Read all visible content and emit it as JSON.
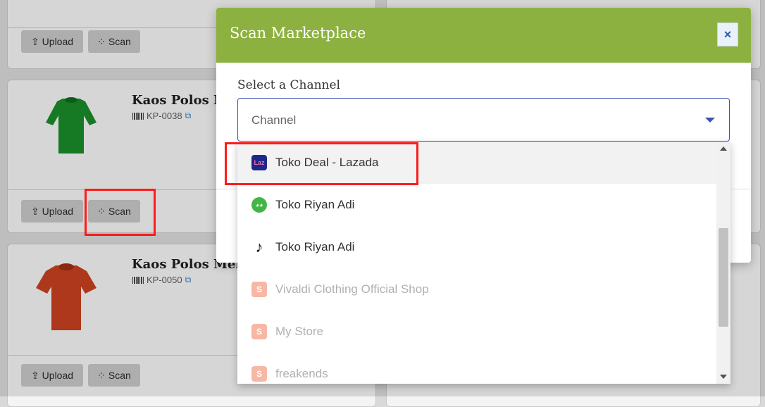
{
  "products": [
    {
      "upload_label": "Upload",
      "scan_label": "Scan"
    },
    {
      "name": "Kaos Polos Ni",
      "sku": "KP-0038",
      "upload_label": "Upload",
      "scan_label": "Scan",
      "color": "#1a8a2a"
    },
    {
      "name": "Kaos Polos Mera",
      "sku": "KP-0050",
      "upload_label": "Upload",
      "scan_label": "Scan",
      "color": "#c6401f"
    }
  ],
  "modal": {
    "title": "Scan Marketplace",
    "close_icon": "×",
    "field_label": "Select a Channel",
    "select_placeholder": "Channel"
  },
  "channels": [
    {
      "label": "Toko Deal - Lazada",
      "icon": "lazada-logo-icon",
      "logo_text": "Laz",
      "state": "active"
    },
    {
      "label": "Toko Riyan Adi",
      "icon": "tokopedia-logo-icon",
      "logo_text": "◕◕",
      "state": "enabled"
    },
    {
      "label": "Toko Riyan Adi",
      "icon": "tiktok-logo-icon",
      "logo_text": "♪",
      "state": "enabled"
    },
    {
      "label": "Vivaldi Clothing Official Shop",
      "icon": "shopee-logo-icon",
      "logo_text": "S",
      "state": "disabled"
    },
    {
      "label": "My Store",
      "icon": "shopee-logo-icon",
      "logo_text": "S",
      "state": "disabled"
    },
    {
      "label": "freakends",
      "icon": "shopee-logo-icon",
      "logo_text": "S",
      "state": "disabled"
    }
  ],
  "colors": {
    "header_green": "#8db141",
    "select_border": "#3f51b5",
    "highlight_red": "#ff1a1a"
  }
}
